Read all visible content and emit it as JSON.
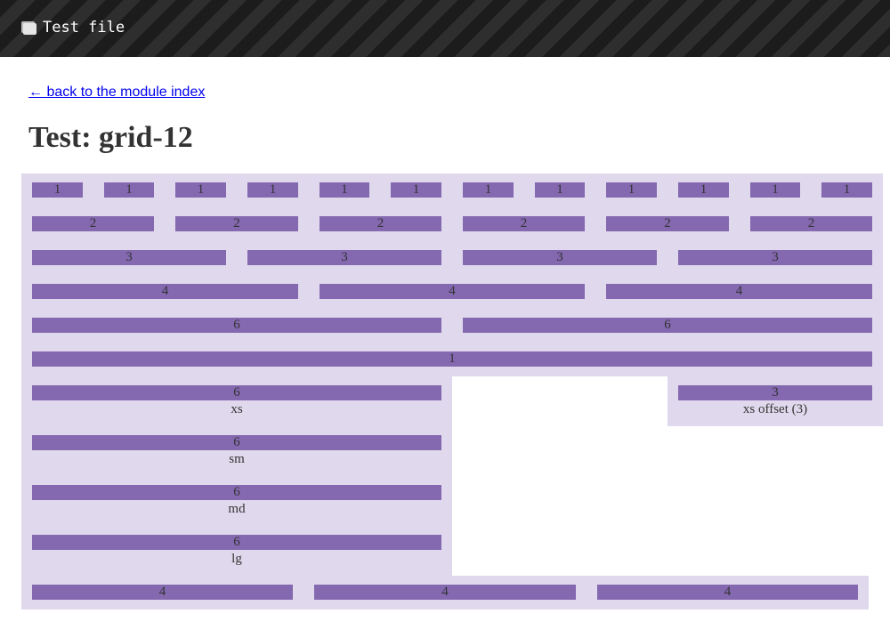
{
  "header": {
    "title": "Test file",
    "icon": "file-icon"
  },
  "back_link": "← back to the module index",
  "heading": "Test: grid-12",
  "rows": {
    "r1": [
      "1",
      "1",
      "1",
      "1",
      "1",
      "1",
      "1",
      "1",
      "1",
      "1",
      "1",
      "1"
    ],
    "r2": [
      "2",
      "2",
      "2",
      "2",
      "2",
      "2"
    ],
    "r3": [
      "3",
      "3",
      "3",
      "3"
    ],
    "r4": [
      "4",
      "4",
      "4"
    ],
    "r5": [
      "6",
      "6"
    ],
    "r6": [
      "1"
    ],
    "r11": [
      "4",
      "4",
      "4"
    ]
  },
  "responsive": [
    {
      "value": "6",
      "caption": "xs"
    },
    {
      "value": "6",
      "caption": "sm"
    },
    {
      "value": "6",
      "caption": "md"
    },
    {
      "value": "6",
      "caption": "lg"
    }
  ],
  "offset_cell": {
    "value": "3",
    "caption": "xs offset (3)"
  },
  "colors": {
    "cell": "#8468b0",
    "background": "#e0d8ec",
    "link": "#0000ee",
    "header": "#1c1c1c"
  }
}
